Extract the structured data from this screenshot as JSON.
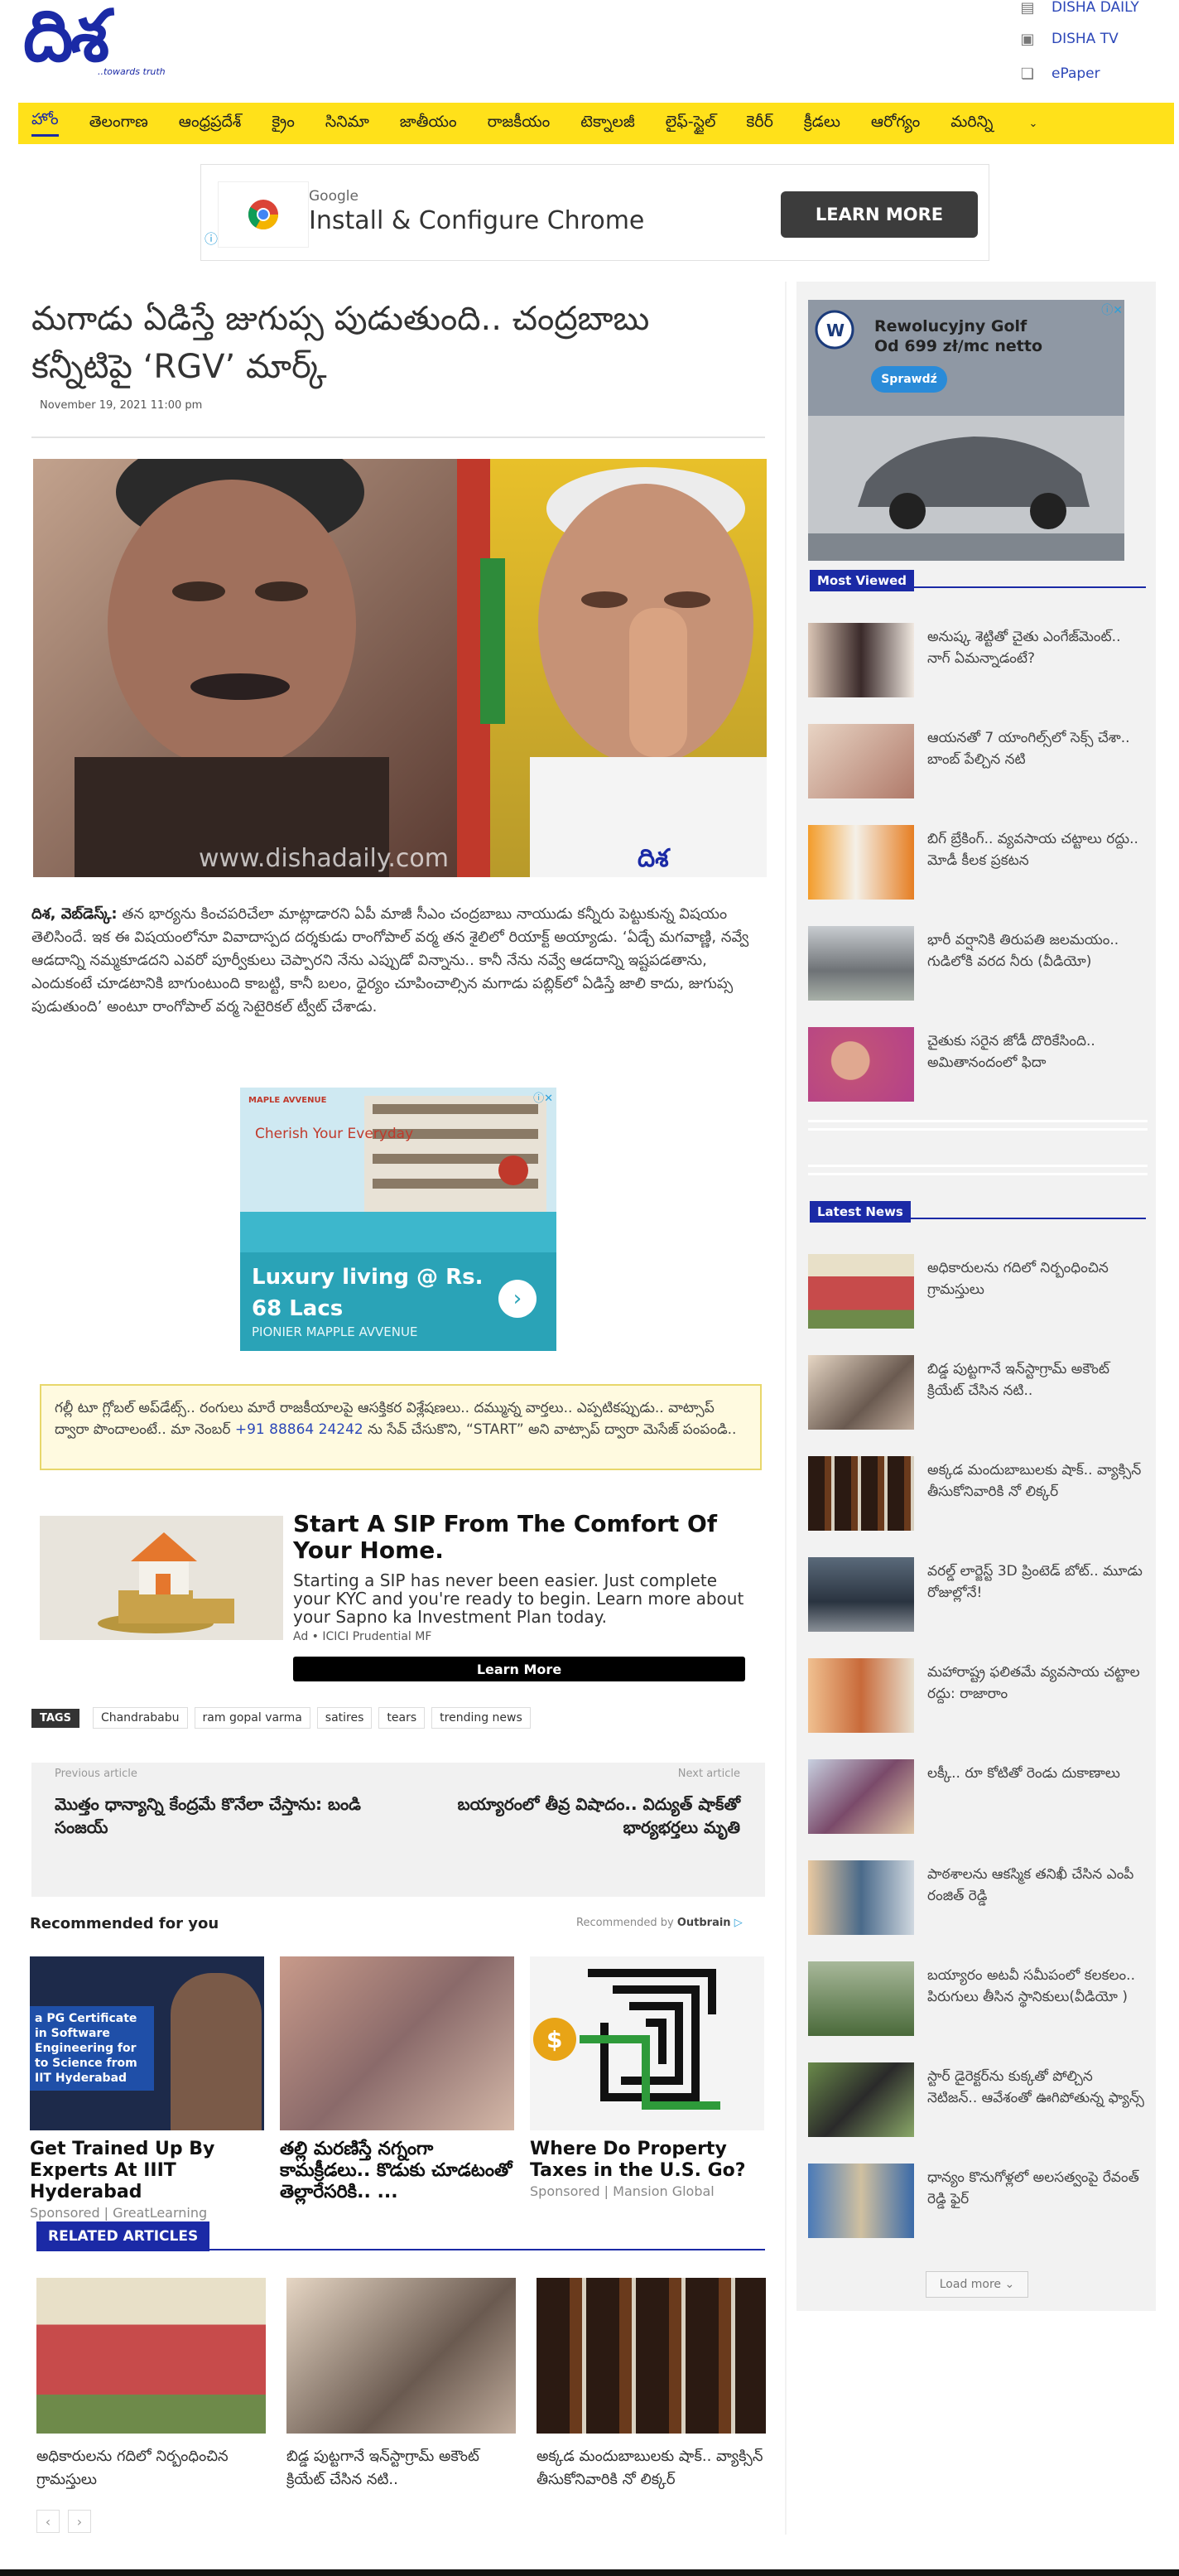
{
  "brand": {
    "logo_text": "దిశ",
    "tagline": "..towards truth"
  },
  "top_links": [
    {
      "label": "DISHA DAILY",
      "icon": "newspaper-icon"
    },
    {
      "label": "DISHA TV",
      "icon": "tv-icon"
    },
    {
      "label": "ePaper",
      "icon": "epaper-icon"
    }
  ],
  "nav": {
    "items": [
      "హోం",
      "తెలంగాణ",
      "ఆంధ్రప్రదేశ్",
      "క్రైం",
      "సినిమా",
      "జాతీయం",
      "రాజకీయం",
      "టెక్నాలజీ",
      "లైఫ్-స్టైల్",
      "కెరీర్",
      "క్రీడలు",
      "ఆరోగ్యం",
      "మరిన్ని"
    ],
    "more_icon": "chevron-down-icon"
  },
  "top_ad": {
    "brand": "Google",
    "title": "Install & Configure Chrome",
    "button": "LEARN MORE"
  },
  "article": {
    "title": "మగాడు ఏడిస్తే జుగుప్స పుడుతుంది.. చంద్రబాబు కన్నీటిపై ‘RGV’ మార్క్",
    "date": "November 19, 2021 11:00 pm",
    "image_watermark": "www.dishadaily.com",
    "image_logo": "దిశ",
    "dateline": "దిశ, వెబ్‌డెస్క్:",
    "body": "తన భార్యను కించపరిచేలా మాట్లాడారని ఏపీ మాజీ సీఎం చంద్రబాబు నాయుడు కన్నీరు పెట్టుకున్న విషయం తెలిసిందే. ఇక ఈ విషయంలోనూ వివాదాస్పద దర్శకుడు రాంగోపాల్ వర్మ తన శైలిలో రియాక్ట్ అయ్యాడు. ‘ఏడ్చే మగవాణ్ణి, నవ్వే ఆడదాన్ని నమ్మకూడదని ఎవరో పూర్వీకులు చెప్పారని నేను ఎప్పుడో విన్నాను.. కానీ నేను నవ్వే ఆడదాన్ని ఇష్టపడతాను, ఎందుకంటే చూడటానికి బాగుంటుంది కాబట్టి, కానీ బలం, ధైర్యం చూపించాల్సిన మగాడు పబ్లిక్‌లో ఏడిస్తే జాలి కాదు, జుగుప్స పుడుతుంది’ అంటూ రాంగోపాల్ వర్మ సెటైరికల్ ట్వీట్ చేశాడు."
  },
  "mid_ad": {
    "brand": "MAPLE AVVENUE",
    "tagline": "Cherish Your Everyday",
    "headline": "Luxury living @ Rs. 68 Lacs",
    "sub": "PIONIER MAPPLE AVVENUE"
  },
  "notice": {
    "text_before": "గల్లీ టూ గ్లోబల్ అప్‌డేట్స్.. రంగులు మారే రాజకీయాలపై ఆసక్తికర విశ్లేషణలు.. దమ్మున్న వార్తలు.. ఎప్పటికప్పుడు.. వాట్సాప్ ద్వారా పొందాలంటే.. మా నెంబర్",
    "phone": "+91 88864 24242",
    "text_after": "ను సేవ్ చేసుకొని, “START” అని వాట్సాప్ ద్వారా మెసేజ్ పంపండి.."
  },
  "sip_ad": {
    "title": "Start A SIP From The Comfort Of Your Home.",
    "desc": "Starting a SIP has never been easier. Just complete your KYC and you're ready to begin. Learn more about your Sapno ka Investment Plan today.",
    "advertiser": "Ad • ICICI Prudential MF",
    "button": "Learn More"
  },
  "tags": {
    "label": "TAGS",
    "items": [
      "Chandrababu",
      "ram gopal varma",
      "satires",
      "tears",
      "trending news"
    ]
  },
  "prev_next": {
    "prev_label": "Previous article",
    "prev_title": "మొత్తం ధాన్యాన్ని కేంద్రమే కొనేలా చేస్తాను: బండి సంజయ్",
    "next_label": "Next article",
    "next_title": "బయ్యారంలో తీవ్ర విషాదం.. విద్యుత్ షాక్‌తో భార్యభర్తలు మృతి"
  },
  "recommended": {
    "heading": "Recommended for you",
    "by": "Recommended by",
    "by_brand": "Outbrain",
    "cards": [
      {
        "title": "Get Trained Up By Experts At IIIT Hyderabad",
        "source": "Sponsored | GreatLearning",
        "img_text": "a PG Certificate in Software Engineering for to Science from IIT Hyderabad"
      },
      {
        "title": "తల్లి మరణిస్తే నగ్నంగా కామక్రీడలు.. కొడుకు చూడటంతో తెల్లారేసరికి.. ...",
        "source": ""
      },
      {
        "title": "Where Do Property Taxes in the U.S. Go?",
        "source": "Sponsored | Mansion Global"
      }
    ]
  },
  "related": {
    "heading": "RELATED ARTICLES",
    "items": [
      {
        "title": "అధికారులను గదిలో నిర్బంధించిన గ్రామస్తులు"
      },
      {
        "title": "బిడ్డ పుట్టగానే ఇన్‌స్టాగ్రామ్ అకౌంట్ క్రియేట్ చేసిన నటి.."
      },
      {
        "title": "అక్కడ మందుబాబులకు షాక్.. వ్యాక్సిన్ తీసుకోనివారికి నో లిక్కర్"
      }
    ],
    "prev": "‹",
    "next": "›"
  },
  "sidebar": {
    "ad": {
      "title": "Rewolucyjny Golf",
      "price": "Od 699 zł/mc netto",
      "button": "Sprawdź"
    },
    "most_viewed": {
      "heading": "Most Viewed",
      "items": [
        "అనుష్క శెట్టితో చైతు ఎంగేజ్‌మెంట్.. నాగ్ ఏమన్నాడంటే?",
        "ఆయనతో 7 యాంగిల్స్‌లో సెక్స్ చేశా.. బాంబ్ పేల్చిన నటి",
        "బిగ్ బ్రేకింగ్.. వ్యవసాయ చట్టాలు రద్దు.. మోడీ కీలక ప్రకటన",
        "భారీ వర్షానికి తిరుపతి జలమయం.. గుడిలోకి వరద నీరు (వీడియో)",
        "చైతుకు సరైన జోడీ దొరికేసింది.. అమితానందంలో ఫిదా"
      ]
    },
    "latest_news": {
      "heading": "Latest News",
      "items": [
        "అధికారులను గదిలో నిర్బంధించిన గ్రామస్తులు",
        "బిడ్డ పుట్టగానే ఇన్‌స్టాగ్రామ్ అకౌంట్ క్రియేట్ చేసిన నటి..",
        "అక్కడ మందుబాబులకు షాక్.. వ్యాక్సిన్ తీసుకోనివారికి నో లిక్కర్",
        "వరల్డ్ లార్జెస్ట్ 3D ప్రింటెడ్ బోట్.. మూడు రోజుల్లోనే!",
        "మహారాష్ట్ర ఫలితమే వ్యవసాయ చట్టాల రద్దు: రాజారాం",
        "లక్కీ.. రూ కోటితో రెండు దుకాణాలు",
        "పాఠశాలను ఆకస్మిక తనిఖీ చేసిన ఎంపీ రంజిత్ రెడ్డి",
        "బయ్యారం అటవీ సమీపంలో కలకలం.. పిరుగులు తీసిన స్థానికులు(వీడియో )",
        "స్టార్ డైరెక్టర్‌ను కుక్కతో పోల్చిన నెటిజన్.. ఆవేశంతో ఊగిపోతున్న ఫ్యాన్స్",
        "ధాన్యం కొనుగోళ్లలో అలసత్వంపై రేవంత్ రెడ్డి ఫైర్"
      ]
    },
    "load_more": "Load more ⌄"
  },
  "colors": {
    "brand_blue": "#1b2aa6",
    "nav_yellow": "#ffe11a"
  }
}
